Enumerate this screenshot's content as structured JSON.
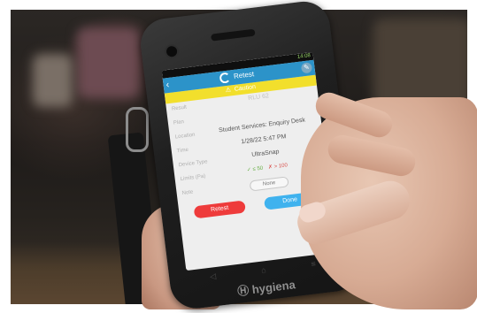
{
  "app": {
    "title": "Retest",
    "status_time": "14:08"
  },
  "banner": {
    "label": "Caution"
  },
  "fields": [
    {
      "label": "Result",
      "value": "RLU 62",
      "faint": true
    },
    {
      "label": "Plan",
      "value": "",
      "faint": true
    },
    {
      "label": "Location",
      "value": "Student Services: Enquiry Desk"
    },
    {
      "label": "Time",
      "value": "1/28/22 5:47 PM"
    },
    {
      "label": "Device Type",
      "value": "UltraSnap"
    }
  ],
  "limits": {
    "label": "Limits (Pa)",
    "pass": "≤ 50",
    "fail": "> 100"
  },
  "note": {
    "label": "Note",
    "button": "None"
  },
  "buttons": {
    "retest": "Retest",
    "done": "Done"
  },
  "brand": "hygiena",
  "icons": {
    "back": "back-arrow-icon",
    "settings": "settings-icon",
    "caution": "warning-icon",
    "check": "check-icon",
    "cross": "cross-icon"
  },
  "colors": {
    "appbar": "#2c93c9",
    "caution": "#f2df2c",
    "retest": "#ee3b3b",
    "done": "#3fb2ee"
  }
}
